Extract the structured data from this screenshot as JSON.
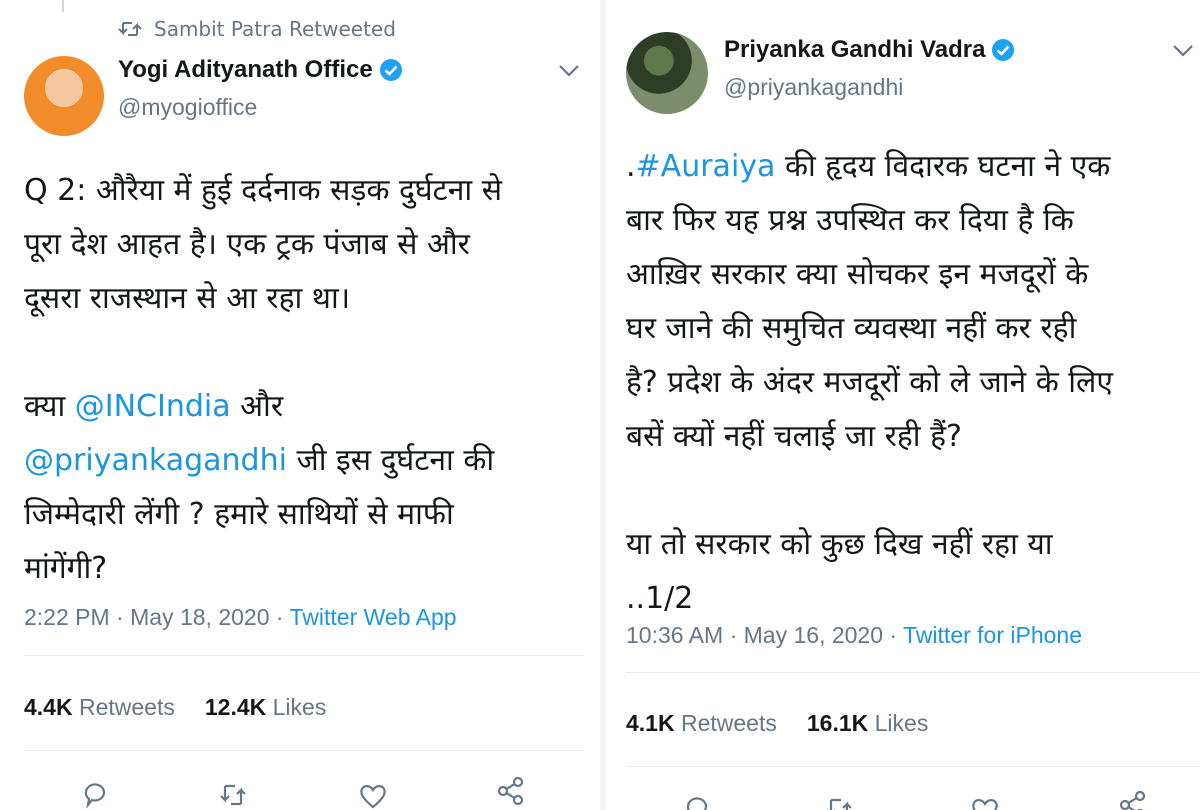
{
  "left_tweet": {
    "retweet_label": "Sambit Patra Retweeted",
    "author_name": "Yogi Adityanath Office",
    "author_handle": "@myogioffice",
    "body_lines_1": [
      "Q 2: औरैया में हुई दर्दनाक सड़क दुर्घटना से",
      "पूरा देश आहत है। एक ट्रक पंजाब से और",
      "दूसरा राजस्थान से आ रहा था।"
    ],
    "line4_prefix": "क्या ",
    "mention_inc": "@INCIndia",
    "line4_suffix": " और",
    "mention_priyanka": "@priyankagandhi",
    "line5_suffix": " जी इस दुर्घटना की",
    "line6": "जिम्मेदारी लेंगी ? हमारे साथियों से माफी",
    "line7": "मांगेंगी?",
    "time": "2:22 PM",
    "date": "May 18, 2020",
    "source": "Twitter Web App",
    "retweets_count": "4.4K",
    "retweets_label": "Retweets",
    "likes_count": "12.4K",
    "likes_label": "Likes"
  },
  "right_tweet": {
    "author_name": "Priyanka Gandhi Vadra",
    "author_handle": "@priyankagandhi",
    "body_line1_prefix": ".",
    "hashtag": "#Auraiya",
    "body_line1_suffix": " की हृदय विदारक घटना ने एक",
    "body_lines": [
      "बार फिर यह प्रश्न उपस्थित कर दिया है कि",
      "आख़िर सरकार क्या सोचकर इन मजदूरों के",
      "घर जाने की समुचित व्यवस्था नहीं कर रही",
      "है? प्रदेश के अंदर मजदूरों को ले जाने के लिए",
      "बसें क्यों नहीं चलाई जा रही हैं?"
    ],
    "body_lines_2": [
      "या तो सरकार को कुछ दिख नहीं रहा या",
      "..1/2"
    ],
    "time": "10:36 AM",
    "date": "May 16, 2020",
    "source": "Twitter for iPhone",
    "retweets_count": "4.1K",
    "retweets_label": "Retweets",
    "likes_count": "16.1K",
    "likes_label": "Likes"
  },
  "colors": {
    "link": "#1b95e0",
    "secondary_text": "#657786",
    "primary_text": "#14171a",
    "divider": "#e6ecf0"
  },
  "icons": [
    "retweet-icon",
    "verified-badge-icon",
    "chevron-down-icon",
    "reply-icon",
    "retweet-icon",
    "like-icon",
    "share-icon"
  ],
  "meta_separator": " · "
}
